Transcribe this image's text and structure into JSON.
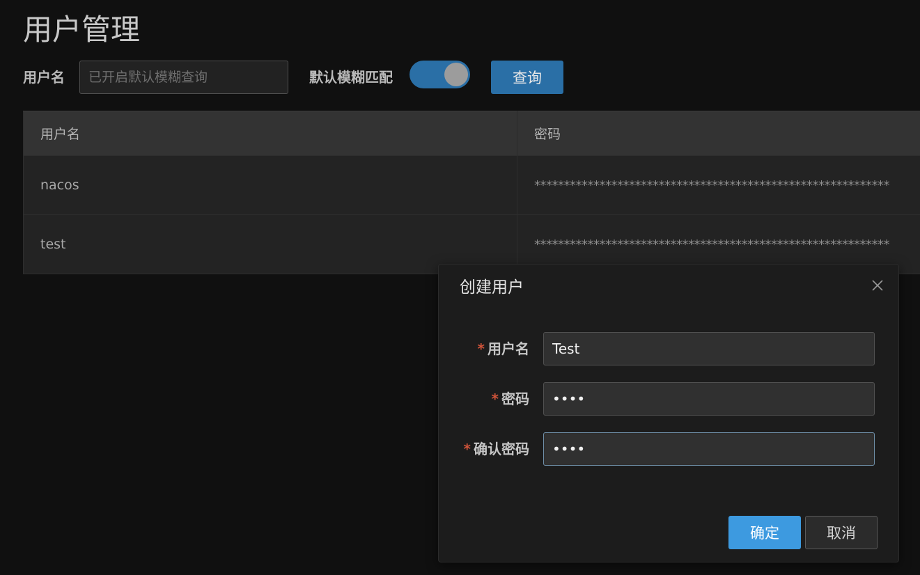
{
  "page": {
    "title": "用户管理"
  },
  "search": {
    "label": "用户名",
    "placeholder": "已开启默认模糊查询",
    "value": "",
    "fuzzy_label": "默认模糊匹配",
    "fuzzy_enabled": true,
    "query_button": "查询"
  },
  "table": {
    "columns": [
      "用户名",
      "密码"
    ],
    "rows": [
      {
        "username": "nacos",
        "password": "************************************************************"
      },
      {
        "username": "test",
        "password": "************************************************************"
      }
    ]
  },
  "dialog": {
    "title": "创建用户",
    "close_icon": "close-icon",
    "fields": [
      {
        "required_mark": "*",
        "label": "用户名",
        "value": "Test",
        "type": "text"
      },
      {
        "required_mark": "*",
        "label": "密码",
        "value": "test",
        "type": "password"
      },
      {
        "required_mark": "*",
        "label": "确认密码",
        "value": "test",
        "type": "password"
      }
    ],
    "ok_button": "确定",
    "cancel_button": "取消"
  },
  "colors": {
    "background": "#101010",
    "accent": "#2a6fa6",
    "primary_button": "#3d9ae0",
    "required": "#d2543a"
  }
}
